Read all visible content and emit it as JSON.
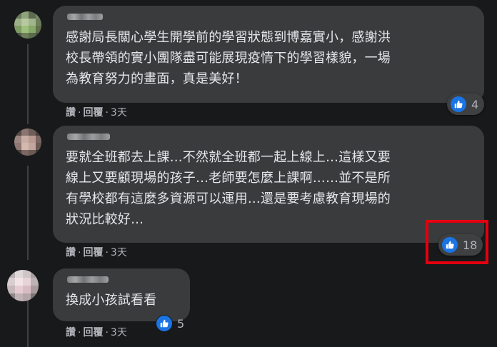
{
  "comments": [
    {
      "text": "感謝局長關心學生開學前的學習狀態到博嘉實小，感謝洪\n校長帶領的實小團隊盡可能展現疫情下的學習樣貌，一場\n為教育努力的畫面，真是美好！",
      "like_label": "讚",
      "reply_label": "回覆",
      "time": "3天",
      "reaction_count": "4"
    },
    {
      "text": "要就全班都去上課…不然就全班都一起上線上…這樣又要\n線上又要顧現場的孩子…老師要怎麼上課啊……並不是所\n有學校都有這麼多資源可以運用…還是要考慮教育現場的\n狀況比較好…",
      "like_label": "讚",
      "reply_label": "回覆",
      "time": "3天",
      "reaction_count": "18"
    },
    {
      "text": "換成小孩試看看",
      "like_label": "讚",
      "reply_label": "回覆",
      "time": "3天",
      "reaction_count": "5"
    }
  ],
  "separator": "·",
  "icons": {
    "reaction": "like-icon"
  },
  "colors": {
    "like_blue": "#1b74e4",
    "highlight_red": "#e3000f"
  }
}
